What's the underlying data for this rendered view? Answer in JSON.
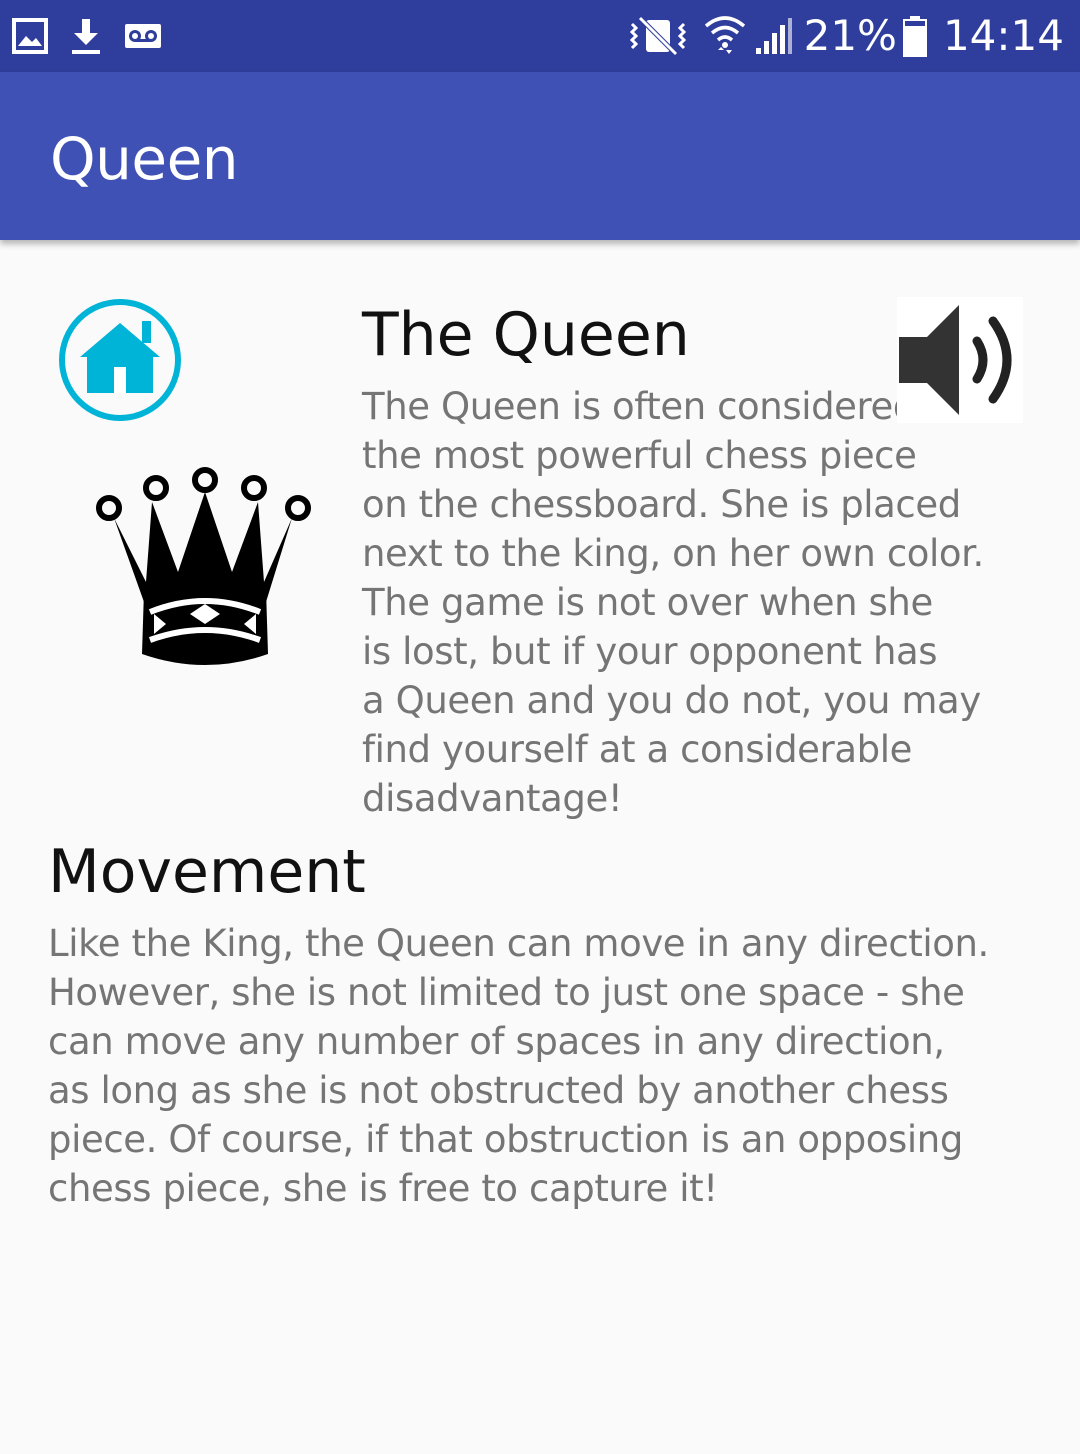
{
  "status_bar": {
    "battery_percent": "21%",
    "time": "14:14",
    "icons": [
      "gallery-icon",
      "download-icon",
      "voicemail-icon",
      "vibrate-icon",
      "wifi-icon",
      "cellular-signal-icon",
      "battery-icon"
    ],
    "background_color": "#2f3e9c"
  },
  "app_bar": {
    "title": "Queen",
    "background_color": "#3f51b5"
  },
  "content": {
    "home_button_icon": "home-icon",
    "home_button_color": "#00b4d8",
    "piece_icon": "chess-queen-icon",
    "sound_button_icon": "speaker-icon",
    "piece_heading": "The Queen",
    "intro_lines": [
      "The Queen is often considered",
      "the most powerful chess piece",
      "on the chessboard. She is placed",
      "next to the king, on her own color.",
      "The game is not over when she",
      "is lost, but if your opponent has",
      "a Queen and you do not, you may",
      "find yourself at a considerable",
      "disadvantage!"
    ],
    "movement_heading": "Movement",
    "movement_lines": [
      "Like the King, the Queen can move in any direction.",
      "However, she is not limited to just one space - she",
      "can move any number of spaces in any direction,",
      "as long as she is not obstructed by another chess",
      "piece. Of course, if that obstruction is an opposing",
      "chess piece, she is free to capture it!"
    ]
  }
}
